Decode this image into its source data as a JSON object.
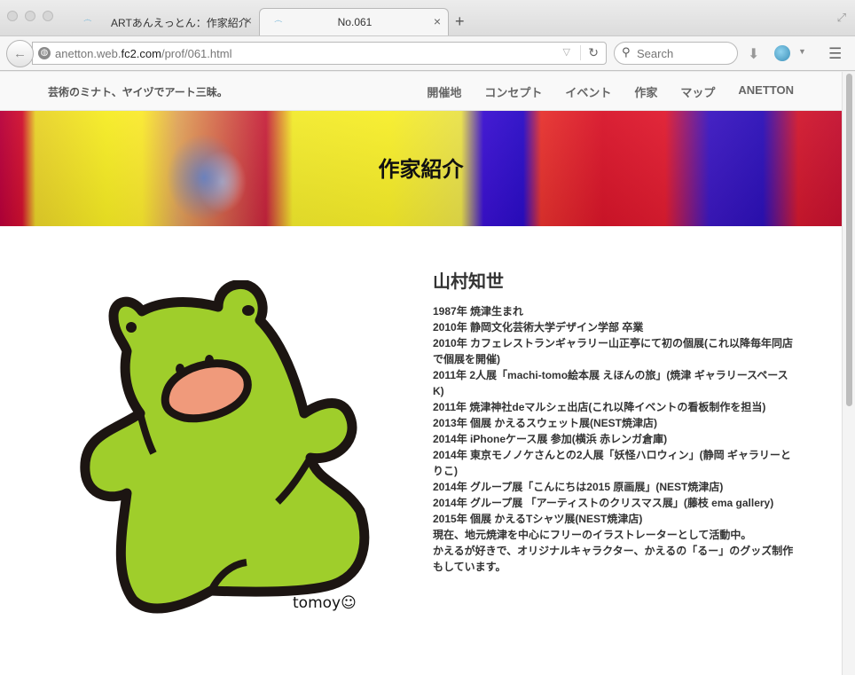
{
  "browser": {
    "tabs": [
      {
        "title": "ARTあんえっとん：作家紹介",
        "active": false
      },
      {
        "title": "No.061",
        "active": true
      }
    ],
    "url": {
      "prefix": "anetton.web.",
      "domain": "fc2.com",
      "path": "/prof/061.html"
    },
    "search": {
      "placeholder": "Search"
    }
  },
  "site": {
    "tagline": "芸術のミナト、ヤイヅでアート三昧。",
    "nav": [
      "開催地",
      "コンセプト",
      "イベント",
      "作家",
      "マップ",
      "ANETTON"
    ],
    "hero_title": "作家紹介"
  },
  "profile": {
    "name": "山村知世",
    "signature": "tomoy☺",
    "bio": [
      "1987年 焼津生まれ",
      "2010年 静岡文化芸術大学デザイン学部 卒業",
      "2010年 カフェレストランギャラリー山正亭にて初の個展(これ以降毎年同店で個展を開催)",
      "2011年 2人展「machi-tomo絵本展 えほんの旅」(焼津 ギャラリースペースK)",
      "2011年 焼津神社deマルシェ出店(これ以降イベントの看板制作を担当)",
      "2013年 個展 かえるスウェット展(NEST焼津店)",
      "2014年 iPhoneケース展 参加(横浜 赤レンガ倉庫)",
      "2014年 東京モノノケさんとの2人展「妖怪ハロウィン」(静岡 ギャラリーとりこ)",
      "2014年 グループ展「こんにちは2015 原画展」(NEST焼津店)",
      "2014年 グループ展 「アーティストのクリスマス展」(藤枝 ema gallery)",
      "2015年 個展 かえるTシャツ展(NEST焼津店)",
      "現在、地元焼津を中心にフリーのイラストレーターとして活動中。",
      "かえるが好きで、オリジナルキャラクター、かえるの「るー」のグッズ制作もしています。"
    ]
  }
}
